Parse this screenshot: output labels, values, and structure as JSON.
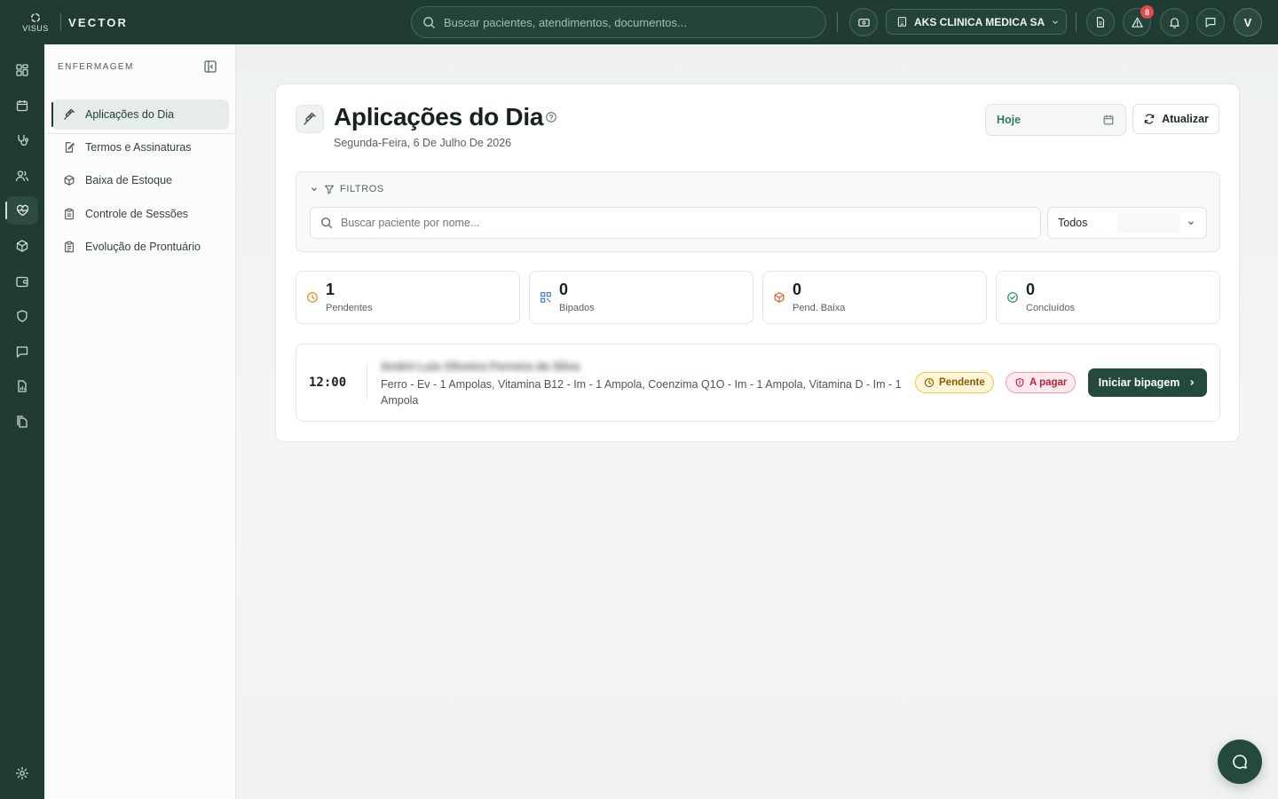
{
  "brand": {
    "logo_text": "VISUS",
    "name": "VECTOR"
  },
  "topbar": {
    "search_placeholder": "Buscar pacientes, atendimentos, documentos...",
    "clinic_name": "AKS CLINICA MEDICA SA",
    "alerts_count": "8",
    "user_initial": "V"
  },
  "subnav": {
    "section_title": "ENFERMAGEM",
    "items": [
      {
        "label": "Aplicações do Dia",
        "icon": "syringe-icon",
        "active": true
      },
      {
        "label": "Termos e Assinaturas",
        "icon": "file-signature-icon"
      },
      {
        "label": "Baixa de Estoque",
        "icon": "package-icon"
      },
      {
        "label": "Controle de Sessões",
        "icon": "clipboard-icon"
      },
      {
        "label": "Evolução de Prontuário",
        "icon": "clipboard-list-icon"
      }
    ]
  },
  "page": {
    "title": "Aplicações do Dia",
    "subtitle": "Segunda-Feira, 6 De Julho De 2026",
    "date_filter": "Hoje",
    "refresh_label": "Atualizar"
  },
  "filters": {
    "title": "FILTROS",
    "search_placeholder": "Buscar paciente por nome...",
    "status_selected": "Todos"
  },
  "stats": [
    {
      "value": "1",
      "label": "Pendentes",
      "icon": "clock-icon",
      "color": "#d9911a"
    },
    {
      "value": "0",
      "label": "Bipados",
      "icon": "qr-code-icon",
      "color": "#2f6fd6"
    },
    {
      "value": "0",
      "label": "Pend. Baixa",
      "icon": "package-icon",
      "color": "#e0602a"
    },
    {
      "value": "0",
      "label": "Concluídos",
      "icon": "check-circle-icon",
      "color": "#2c8a68"
    }
  ],
  "appointments": [
    {
      "time": "12:00",
      "patient": "André Luis Oliveira Ferreira da Silva",
      "items": "Ferro - Ev - 1 Ampolas, Vitamina B12 - Im - 1 Ampola, Coenzima Q1O - Im - 1 Ampola, Vitamina D - Im - 1 Ampola",
      "status": "Pendente",
      "payment": "A pagar",
      "action": "Iniciar bipagem"
    }
  ],
  "colors": {
    "primary": "#1f3b32",
    "accent": "#2c7a5e"
  }
}
